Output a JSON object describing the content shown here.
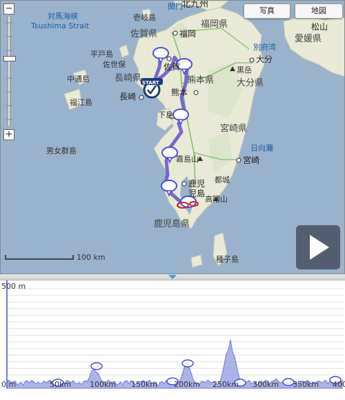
{
  "map": {
    "buttons": {
      "photo": "写真",
      "map": "地図"
    },
    "zoom": {
      "in": "+",
      "out": "−"
    },
    "scale_label": "100 km",
    "start_label": "START",
    "labels": {
      "tsushima_jp": "対馬海峡",
      "tsushima_en": "Tsushima Strait",
      "iki": "壱岐島",
      "saga_pref": "佐賀県",
      "fukuoka_city": "福岡",
      "fukuoka_pref": "福岡県",
      "kitakyushu": "北九州",
      "kanmon": "関門",
      "hiradojima": "平戸島",
      "sasebo": "佐世保",
      "nagasaki_pref": "長崎県",
      "saga_city": "佐賀",
      "nakadori": "中通島",
      "fukue": "福江島",
      "nagasaki_city": "長崎",
      "kumamoto_pref": "熊本県",
      "kumamoto_city": "熊本",
      "kurodake": "黒岳",
      "oita_pref": "大分県",
      "oita_city": "大分",
      "beppu_bay": "別府湾",
      "shimoshima": "下島",
      "miyazaki_pref": "宮崎県",
      "danjo": "男女群島",
      "kirishima": "霧島山",
      "miyazaki_city": "宮崎",
      "hyuga_nada": "日向灘",
      "kagoshima": "鹿児",
      "kagoshima2": "児島",
      "miyakonojo": "都城",
      "takakuma": "高隈山",
      "kagoshima_pref": "鹿児島県",
      "tanegashima": "種子島",
      "ehime_pref": "愛媛県",
      "matsuyama": "松山"
    }
  },
  "elevation": {
    "y_max_label": "500 m",
    "x_ticks": [
      "0 m",
      "50km",
      "100km",
      "150km",
      "200km",
      "250km",
      "300km",
      "350km",
      "400"
    ]
  },
  "colors": {
    "sea": "#99b3cc",
    "land": "#e9ead6",
    "route": "#6a5acd",
    "profile_fill": "#8f9be0",
    "profile_line": "#3f4bd0"
  }
}
